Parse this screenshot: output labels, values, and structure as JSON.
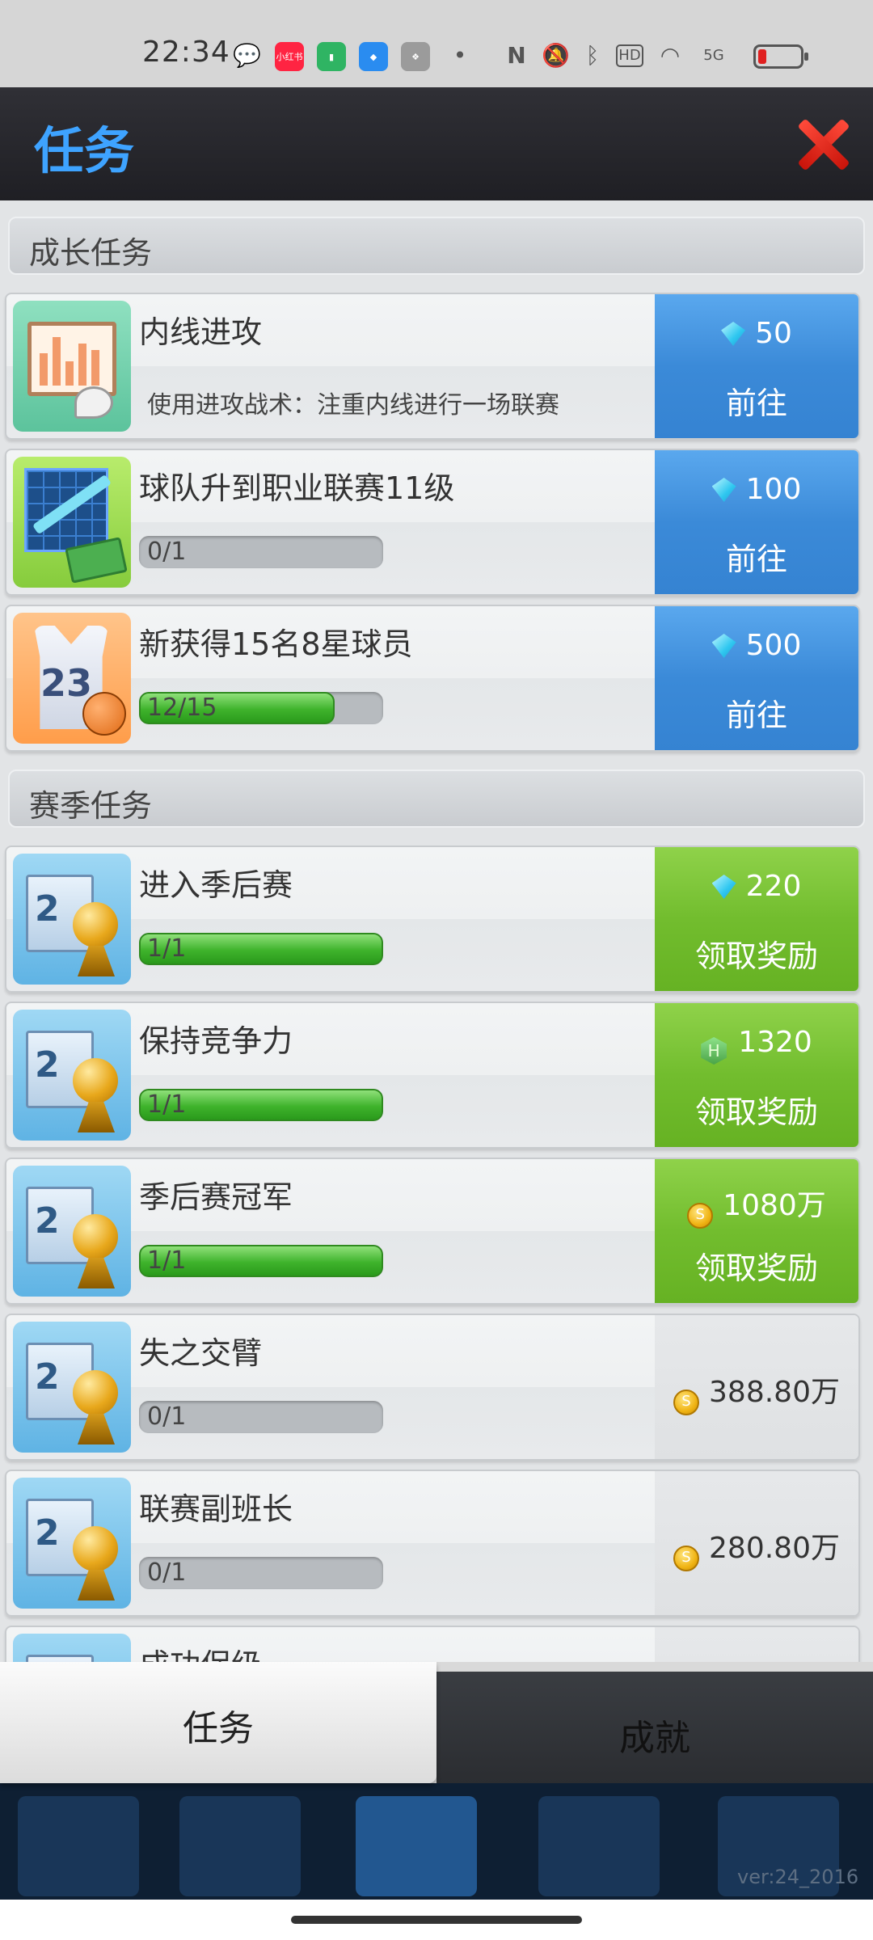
{
  "status_bar": {
    "time": "22:34",
    "app_badge": "小红书",
    "icons": [
      "wechat-icon",
      "xiaohongshu-icon",
      "battery-app-icon",
      "blue-app-icon",
      "game-app-icon",
      "dot-icon",
      "nfc-icon",
      "mute-icon",
      "bluetooth-icon",
      "hd-icon",
      "wifi-icon",
      "5g-signal-icon",
      "battery-icon"
    ],
    "nfc": "N",
    "hd": "HD",
    "net": "5G"
  },
  "dialog": {
    "title": "任务",
    "close_icon": "close-x-icon"
  },
  "sections": [
    {
      "header": "成长任务",
      "tasks": [
        {
          "title": "内线进攻",
          "description": "使用进攻战术：注重内线进行一场联赛",
          "icon": "tactic-board-icon",
          "reward": {
            "currency": "diamond",
            "amount": "50",
            "button": "前往",
            "style": "blue"
          }
        },
        {
          "title": "球队升到职业联赛11级",
          "progress_text": "0/1",
          "progress": 0,
          "icon": "growth-chart-icon",
          "reward": {
            "currency": "diamond",
            "amount": "100",
            "button": "前往",
            "style": "blue"
          }
        },
        {
          "title": "新获得15名8星球员",
          "progress_text": "12/15",
          "progress": 0.8,
          "icon": "jersey-icon",
          "reward": {
            "currency": "diamond",
            "amount": "500",
            "button": "前往",
            "style": "blue"
          }
        }
      ]
    },
    {
      "header": "赛季任务",
      "tasks": [
        {
          "title": "进入季后赛",
          "progress_text": "1/1",
          "progress": 1,
          "icon": "trophy-icon",
          "reward": {
            "currency": "diamond",
            "amount": "220",
            "button": "领取奖励",
            "style": "green"
          }
        },
        {
          "title": "保持竞争力",
          "progress_text": "1/1",
          "progress": 1,
          "icon": "trophy-icon",
          "reward": {
            "currency": "honor",
            "amount": "1320",
            "button": "领取奖励",
            "style": "green"
          }
        },
        {
          "title": "季后赛冠军",
          "progress_text": "1/1",
          "progress": 1,
          "icon": "trophy-icon",
          "reward": {
            "currency": "coin",
            "amount": "1080万",
            "button": "领取奖励",
            "style": "green"
          }
        },
        {
          "title": "失之交臂",
          "progress_text": "0/1",
          "progress": 0,
          "icon": "trophy-icon",
          "reward": {
            "currency": "coin",
            "amount": "388.80万",
            "button": "",
            "style": "none"
          }
        },
        {
          "title": "联赛副班长",
          "progress_text": "0/1",
          "progress": 0,
          "icon": "trophy-icon",
          "reward": {
            "currency": "coin",
            "amount": "280.80万",
            "button": "",
            "style": "none"
          }
        },
        {
          "title": "成功保级",
          "icon": "trophy-icon"
        }
      ]
    }
  ],
  "tabs": [
    {
      "label": "任务",
      "active": true
    },
    {
      "label": "成就",
      "active": false
    }
  ],
  "footer": {
    "version": "ver:24_2016"
  },
  "colors": {
    "title_blue": "#3ea3ff",
    "reward_blue": "#3b8ad8",
    "reward_green": "#72bd2e",
    "close_red": "#e0261a",
    "progress_green": "#3fb32c"
  }
}
